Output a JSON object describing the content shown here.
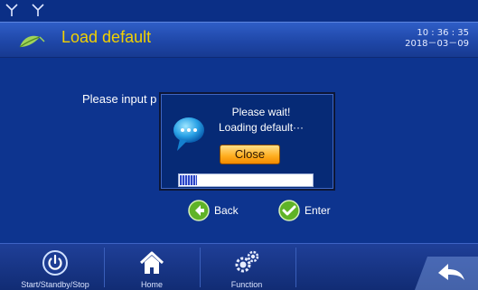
{
  "statusbar": {
    "icons": [
      "antenna-icon",
      "antenna-icon"
    ]
  },
  "header": {
    "title": "Load default",
    "time": "10 : 36 : 35",
    "date": "2018－03－09",
    "icon": "leaf-icon"
  },
  "main": {
    "prompt_text": "Please input p",
    "back_label": "Back",
    "enter_label": "Enter"
  },
  "dialog": {
    "line1": "Please wait!",
    "line2": "Loading default···",
    "close_label": "Close",
    "progress": 0.13
  },
  "footer": {
    "items": [
      {
        "label": "Start/Standby/Stop",
        "icon": "power-icon"
      },
      {
        "label": "Home",
        "icon": "home-icon"
      },
      {
        "label": "Function",
        "icon": "gears-icon"
      }
    ],
    "return_icon": "return-arrow-icon"
  },
  "colors": {
    "title": "#f2d100",
    "background": "#0d348f",
    "button_orange": "#ffad1e",
    "progress_fill": "#2c45c5"
  }
}
